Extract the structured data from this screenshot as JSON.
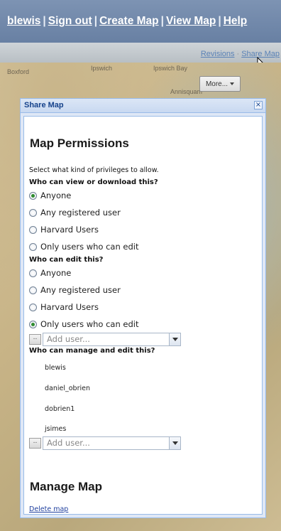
{
  "topbar": {
    "user": "blewis",
    "sign_out": "Sign out",
    "create_map": "Create Map",
    "view_map": "View Map",
    "help": "Help",
    "separator": "|"
  },
  "toolstrip": {
    "revisions": "Revisions",
    "share_map": "Share Map"
  },
  "map": {
    "labels": [
      "Boxford",
      "Ipswich",
      "Ipswich Bay",
      "Annisquam"
    ],
    "more_button": "More..."
  },
  "dialog": {
    "title": "Share Map",
    "close_glyph": "×",
    "permissions_heading": "Map Permissions",
    "instructions": "Select what kind of privileges to allow.",
    "view_question": "Who can view or download this?",
    "view_options": [
      "Anyone",
      "Any registered user",
      "Harvard Users",
      "Only users who can edit"
    ],
    "view_selected": 0,
    "edit_question": "Who can edit this?",
    "edit_options": [
      "Anyone",
      "Any registered user",
      "Harvard Users",
      "Only users who can edit"
    ],
    "edit_selected": 3,
    "add_user_placeholder": "Add user...",
    "manage_question": "Who can manage and edit this?",
    "managers": [
      "blewis",
      "daniel_obrien",
      "dobrien1",
      "jsimes"
    ],
    "manage_heading": "Manage Map",
    "delete_link": "Delete map"
  },
  "colors": {
    "topbar": "#6f87a8",
    "dialog_border": "#99bbe8",
    "dialog_title": "#15428b",
    "radio_selected": "#2f8b2f",
    "link": "#1f3f9e"
  }
}
